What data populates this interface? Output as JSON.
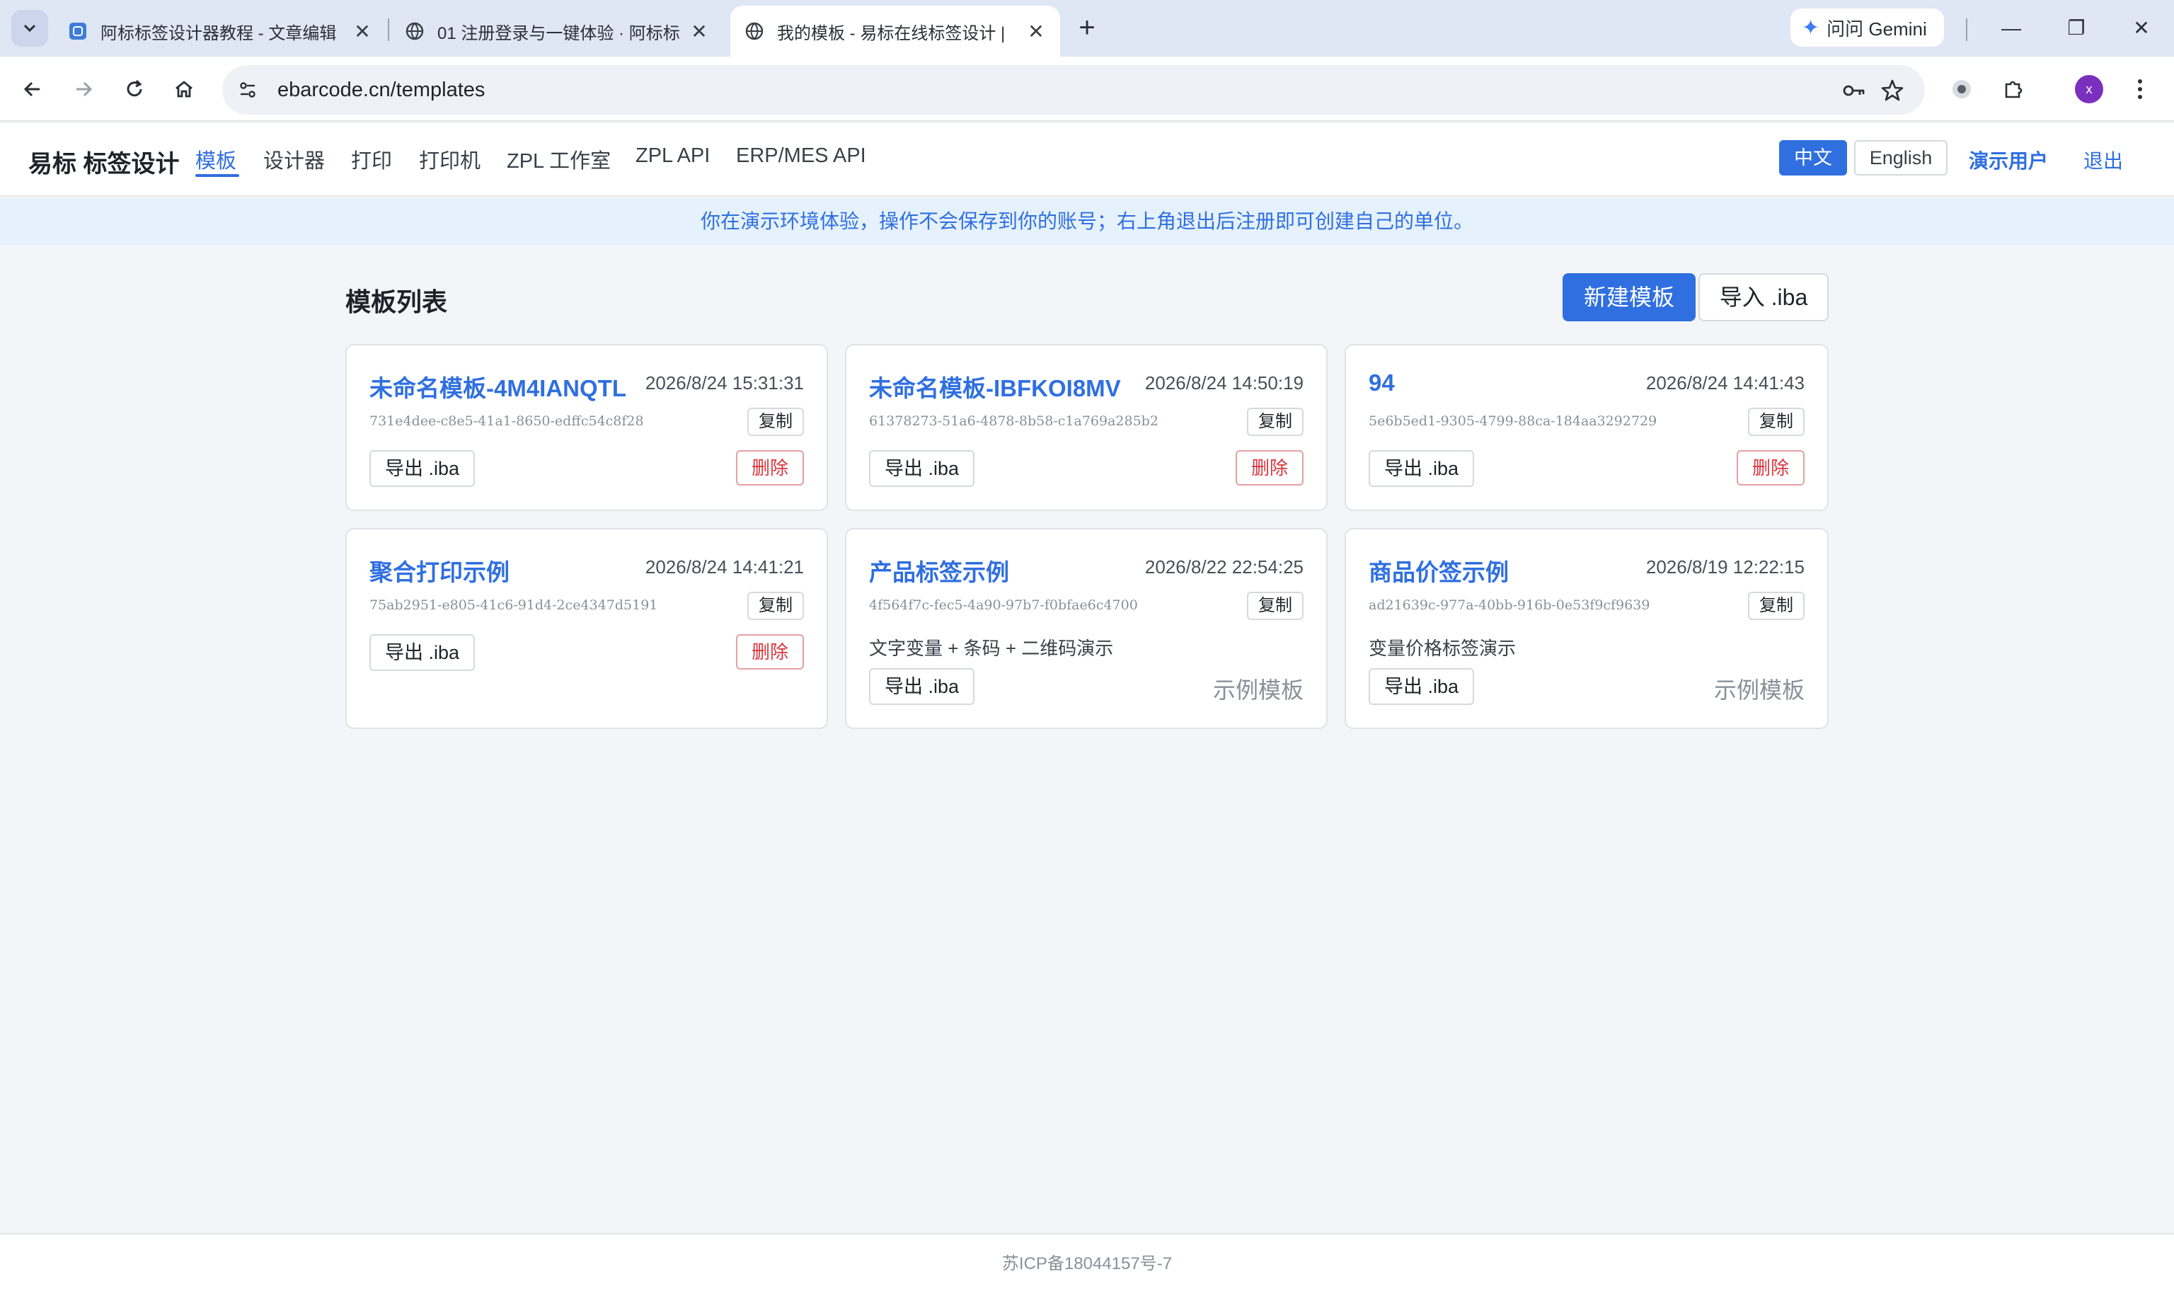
{
  "browser": {
    "tabs": [
      {
        "title": "阿标标签设计器教程 - 文章编辑"
      },
      {
        "title": "01 注册登录与一键体验 · 阿标标"
      },
      {
        "title": "我的模板 - 易标在线标签设计 |"
      }
    ],
    "gemini_label": "问问 Gemini",
    "url": "ebarcode.cn/templates",
    "avatar_letter": "x"
  },
  "app": {
    "brand": "易标 标签设计",
    "nav": [
      "模板",
      "设计器",
      "打印",
      "打印机",
      "ZPL 工作室",
      "ZPL API",
      "ERP/MES API"
    ],
    "lang_zh": "中文",
    "lang_en": "English",
    "demo_user": "演示用户",
    "logout": "退出"
  },
  "notice": "你在演示环境体验，操作不会保存到你的账号；右上角退出后注册即可创建自己的单位。",
  "main": {
    "list_title": "模板列表",
    "new_button": "新建模板",
    "import_button": "导入 .iba",
    "cards": [
      {
        "name": "未命名模板-4M4IANQTL",
        "date": "2026/8/24 15:31:31",
        "uuid": "731e4dee-c8e5-41a1-8650-edffc54c8f28",
        "copy": "复制",
        "export": "导出 .iba",
        "delete": "删除"
      },
      {
        "name": "未命名模板-IBFKOI8MV",
        "date": "2026/8/24 14:50:19",
        "uuid": "61378273-51a6-4878-8b58-c1a769a285b2",
        "copy": "复制",
        "export": "导出 .iba",
        "delete": "删除"
      },
      {
        "name": "94",
        "date": "2026/8/24 14:41:43",
        "uuid": "5e6b5ed1-9305-4799-88ca-184aa3292729",
        "copy": "复制",
        "export": "导出 .iba",
        "delete": "删除"
      },
      {
        "name": "聚合打印示例",
        "date": "2026/8/24 14:41:21",
        "uuid": "75ab2951-e805-41c6-91d4-2ce4347d5191",
        "copy": "复制",
        "export": "导出 .iba",
        "delete": "删除"
      },
      {
        "name": "产品标签示例",
        "date": "2026/8/22 22:54:25",
        "uuid": "4f564f7c-fec5-4a90-97b7-f0bfae6c4700",
        "copy": "复制",
        "desc": "文字变量 + 条码 + 二维码演示",
        "export": "导出 .iba",
        "sample": "示例模板"
      },
      {
        "name": "商品价签示例",
        "date": "2026/8/19 12:22:15",
        "uuid": "ad21639c-977a-40bb-916b-0e53f9cf9639",
        "copy": "复制",
        "desc": "变量价格标签演示",
        "export": "导出 .iba",
        "sample": "示例模板"
      }
    ]
  },
  "footer": "苏ICP备18044157号-7"
}
